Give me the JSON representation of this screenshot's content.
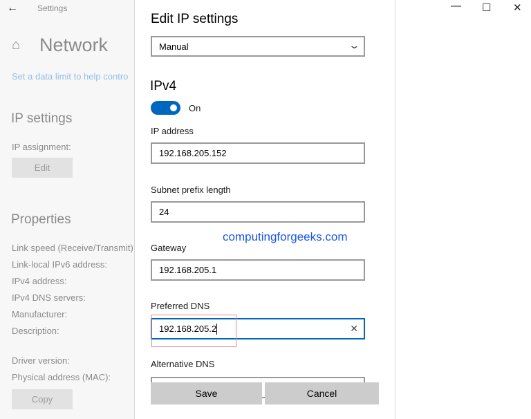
{
  "window": {
    "title": "Settings",
    "controls": {
      "minimize": "—",
      "maximize": "☐",
      "close": "✕"
    }
  },
  "background": {
    "page_title": "Network",
    "data_limit_link": "Set a data limit to help contro",
    "ip_settings_heading": "IP settings",
    "ip_assignment_label": "IP assignment:",
    "edit_button": "Edit",
    "properties_heading": "Properties",
    "properties": [
      "Link speed (Receive/Transmit):",
      "Link-local IPv6 address:",
      "IPv4 address:",
      "IPv4 DNS servers:",
      "Manufacturer:",
      "Description:"
    ],
    "properties2": [
      "Driver version:",
      "Physical address (MAC):"
    ],
    "copy_button": "Copy"
  },
  "dialog": {
    "title": "Edit IP settings",
    "mode": "Manual",
    "section": "IPv4",
    "toggle": {
      "state": "On",
      "on": true,
      "color": "#0067c0"
    },
    "ip_address": {
      "label": "IP address",
      "value": "192.168.205.152"
    },
    "subnet": {
      "label": "Subnet prefix length",
      "value": "24"
    },
    "gateway": {
      "label": "Gateway",
      "value": "192.168.205.1"
    },
    "preferred_dns": {
      "label": "Preferred DNS",
      "value": "192.168.205.2"
    },
    "alternative_dns": {
      "label": "Alternative DNS",
      "value": ""
    },
    "save": "Save",
    "cancel": "Cancel"
  },
  "watermark": "computingforgeeks.com"
}
